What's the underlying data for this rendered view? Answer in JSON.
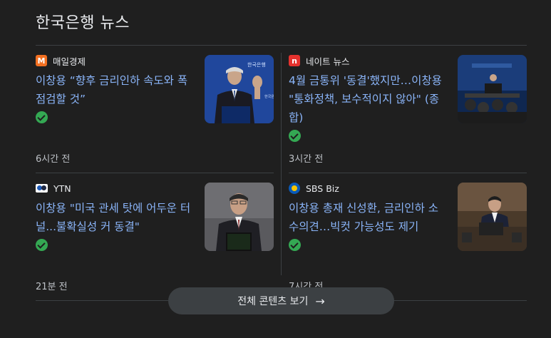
{
  "section": {
    "title": "한국은행 뉴스"
  },
  "articles": [
    {
      "source": "매일경제",
      "source_icon": "maeil-m-logo-icon",
      "source_color": "#f37021",
      "source_glyph": "M",
      "headline": "이창용 “향후 금리인하 속도와 폭 점검할 것”",
      "time": "6시간 전"
    },
    {
      "source": "네이트 뉴스",
      "source_icon": "nate-logo-icon",
      "source_color": "#e5322e",
      "source_glyph": "n",
      "headline": "4월 금통위 '동결'했지만…이창용 \"통화정책, 보수적이지 않아\" (종합)",
      "time": "3시간 전"
    },
    {
      "source": "YTN",
      "source_icon": "ytn-logo-icon",
      "source_color": "#1e5bb8",
      "source_glyph": "",
      "headline": "이창용 \"미국 관세 탓에 어두운 터널...불확실성 커 동결\"",
      "time": "21분 전"
    },
    {
      "source": "SBS Biz",
      "source_icon": "sbs-biz-logo-icon",
      "source_color": "#0a5ab8",
      "source_glyph": "",
      "headline": "이창용 총재 신성환, 금리인하 소수의견…빅컷 가능성도 제기",
      "time": "7시간 전"
    }
  ],
  "more_button": {
    "label": "전체 콘텐츠 보기",
    "icon": "arrow-right-icon"
  }
}
